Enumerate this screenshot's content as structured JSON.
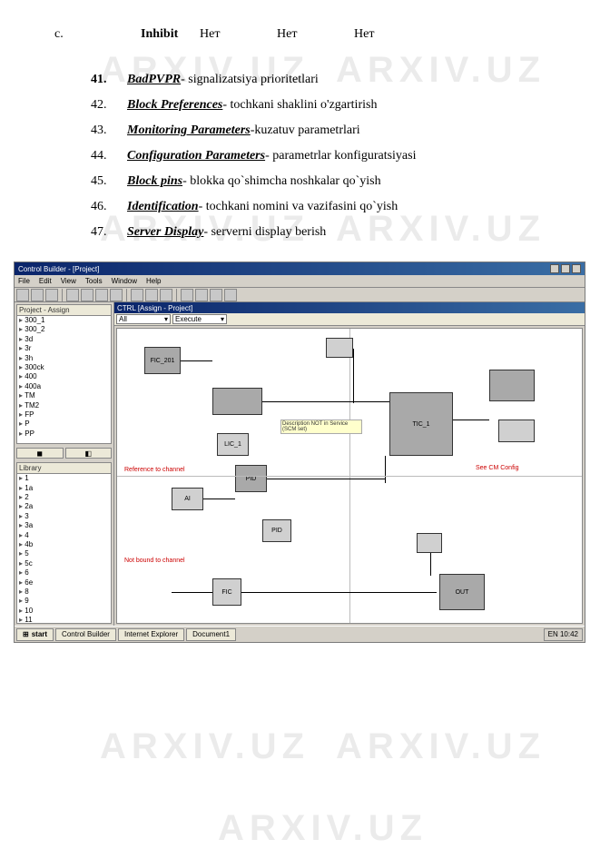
{
  "watermarks": {
    "text": "ARXIV.UZ"
  },
  "table_row": {
    "col_c": "c.",
    "inhibit": "Inhibit",
    "net1": "Нет",
    "net2": "Нет",
    "net3": "Нет"
  },
  "list": [
    {
      "num": "41.",
      "bold": true,
      "term": "BadPVPR",
      "desc": "- signalizatsiya prioritetlari"
    },
    {
      "num": "42.",
      "bold": false,
      "term": "Block Preferences",
      "desc": "-  tochkani shaklini o'zgartirish"
    },
    {
      "num": "43.",
      "bold": false,
      "term": "Monitoring Parameters",
      "desc": "-kuzatuv parametrlari"
    },
    {
      "num": "44.",
      "bold": false,
      "term": "Configuration Parameters",
      "desc": "- parametrlar konfiguratsiyasi"
    },
    {
      "num": "45.",
      "bold": false,
      "term": "Block pins",
      "desc": "- blokka qo`shimcha noshkalar qo`yish"
    },
    {
      "num": "46.",
      "bold": false,
      "term": "Identification",
      "desc": "-  tochkani nomini va vazifasini qo`yish"
    },
    {
      "num": "47.",
      "bold": false,
      "term": "Server Display",
      "desc": "-  serverni display berish"
    }
  ],
  "app": {
    "title": "Control Builder - [Project]",
    "menus": [
      "File",
      "Edit",
      "View",
      "Tools",
      "Window",
      "Help"
    ],
    "mdi_title": "CTRL [Assign - Project]",
    "dropdown1": "All",
    "dropdown2": "Execute",
    "left_panel1_title": "Project - Assign",
    "left_panel2_title": "Library",
    "tree1": [
      "300_1",
      "300_2",
      "3d",
      "3r",
      "3h",
      "300ck",
      "400",
      "400a",
      "TM",
      "TM2",
      "FP",
      "P",
      "PP"
    ],
    "left_buttons": [
      "◼",
      "◧"
    ],
    "tree2": [
      "1",
      "1a",
      "2",
      "2a",
      "3",
      "3a",
      "4",
      "4b",
      "5",
      "5c",
      "6",
      "6e",
      "8",
      "9",
      "10",
      "11"
    ],
    "blocks": {
      "b1": "FIC_201",
      "b2": "",
      "b3": "",
      "b4": "",
      "b5": "LIC_1",
      "b6": "PID",
      "b7": "AI",
      "b8": "TIC_1",
      "b9": "PID",
      "b10": "",
      "b11": "FIC",
      "b12": "OUT"
    },
    "annotations": {
      "y1": "Description NOT in Service (SCM set)",
      "red1": "Reference to channel",
      "red2": "Not bound to channel",
      "red3": "See CM Config"
    },
    "taskbar": {
      "start": "start",
      "tasks": [
        "Control Builder",
        "Internet Explorer",
        "Document1"
      ],
      "clock": "EN  10:42"
    }
  }
}
